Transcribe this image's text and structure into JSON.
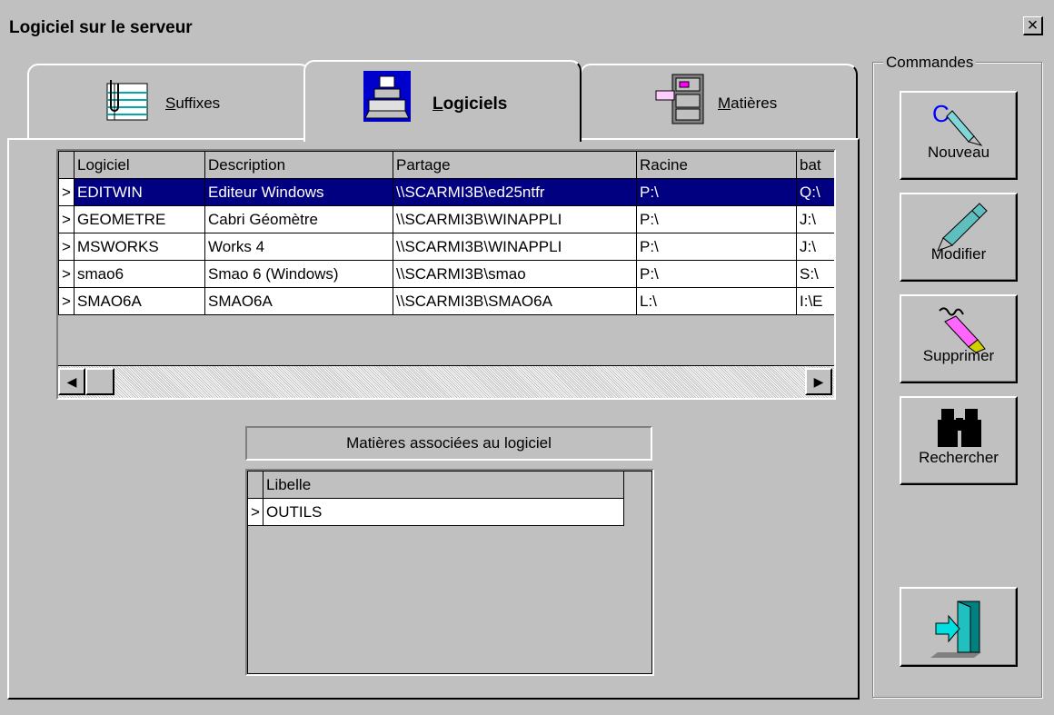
{
  "window": {
    "title": "Logiciel sur le serveur",
    "close_glyph": "×"
  },
  "tabs": [
    {
      "label_prefix": "",
      "label_underline": "S",
      "label_rest": "uffixes",
      "icon": "notebook-icon"
    },
    {
      "label_prefix": "",
      "label_underline": "L",
      "label_rest": "ogiciels",
      "icon": "computer-icon"
    },
    {
      "label_prefix": "",
      "label_underline": "M",
      "label_rest": "atières",
      "icon": "filing-cabinet-icon"
    }
  ],
  "grid": {
    "columns": [
      "Logiciel",
      "Description",
      "Partage",
      "Racine",
      "bat"
    ],
    "rows": [
      {
        "marker": ">",
        "cells": [
          "EDITWIN",
          "Editeur Windows",
          "\\\\SCARMI3B\\ed25ntfr",
          "P:\\",
          "Q:\\"
        ]
      },
      {
        "marker": ">",
        "cells": [
          "GEOMETRE",
          "Cabri Géomètre",
          "\\\\SCARMI3B\\WINAPPLI",
          "P:\\",
          "J:\\"
        ]
      },
      {
        "marker": ">",
        "cells": [
          "MSWORKS",
          "Works 4",
          "\\\\SCARMI3B\\WINAPPLI",
          "P:\\",
          "J:\\"
        ]
      },
      {
        "marker": ">",
        "cells": [
          "smao6",
          "Smao 6 (Windows)",
          "\\\\SCARMI3B\\smao",
          "P:\\",
          "S:\\"
        ]
      },
      {
        "marker": ">",
        "cells": [
          "SMAO6A",
          "SMAO6A",
          "\\\\SCARMI3B\\SMAO6A",
          "L:\\",
          "I:\\E"
        ]
      }
    ],
    "scroll_left": "◀",
    "scroll_right": "▶"
  },
  "associated": {
    "caption": "Matières associées au logiciel",
    "column": "Libelle",
    "rows": [
      {
        "marker": ">",
        "value": "OUTILS"
      }
    ]
  },
  "commands": {
    "label": "Commandes",
    "buttons": [
      {
        "label": "Nouveau",
        "icon": "new-pen-icon"
      },
      {
        "label": "Modifier",
        "icon": "edit-pen-icon"
      },
      {
        "label": "Supprimer",
        "icon": "eraser-icon"
      },
      {
        "label": "Rechercher",
        "icon": "binoculars-icon"
      }
    ],
    "exit_icon": "exit-door-icon"
  }
}
